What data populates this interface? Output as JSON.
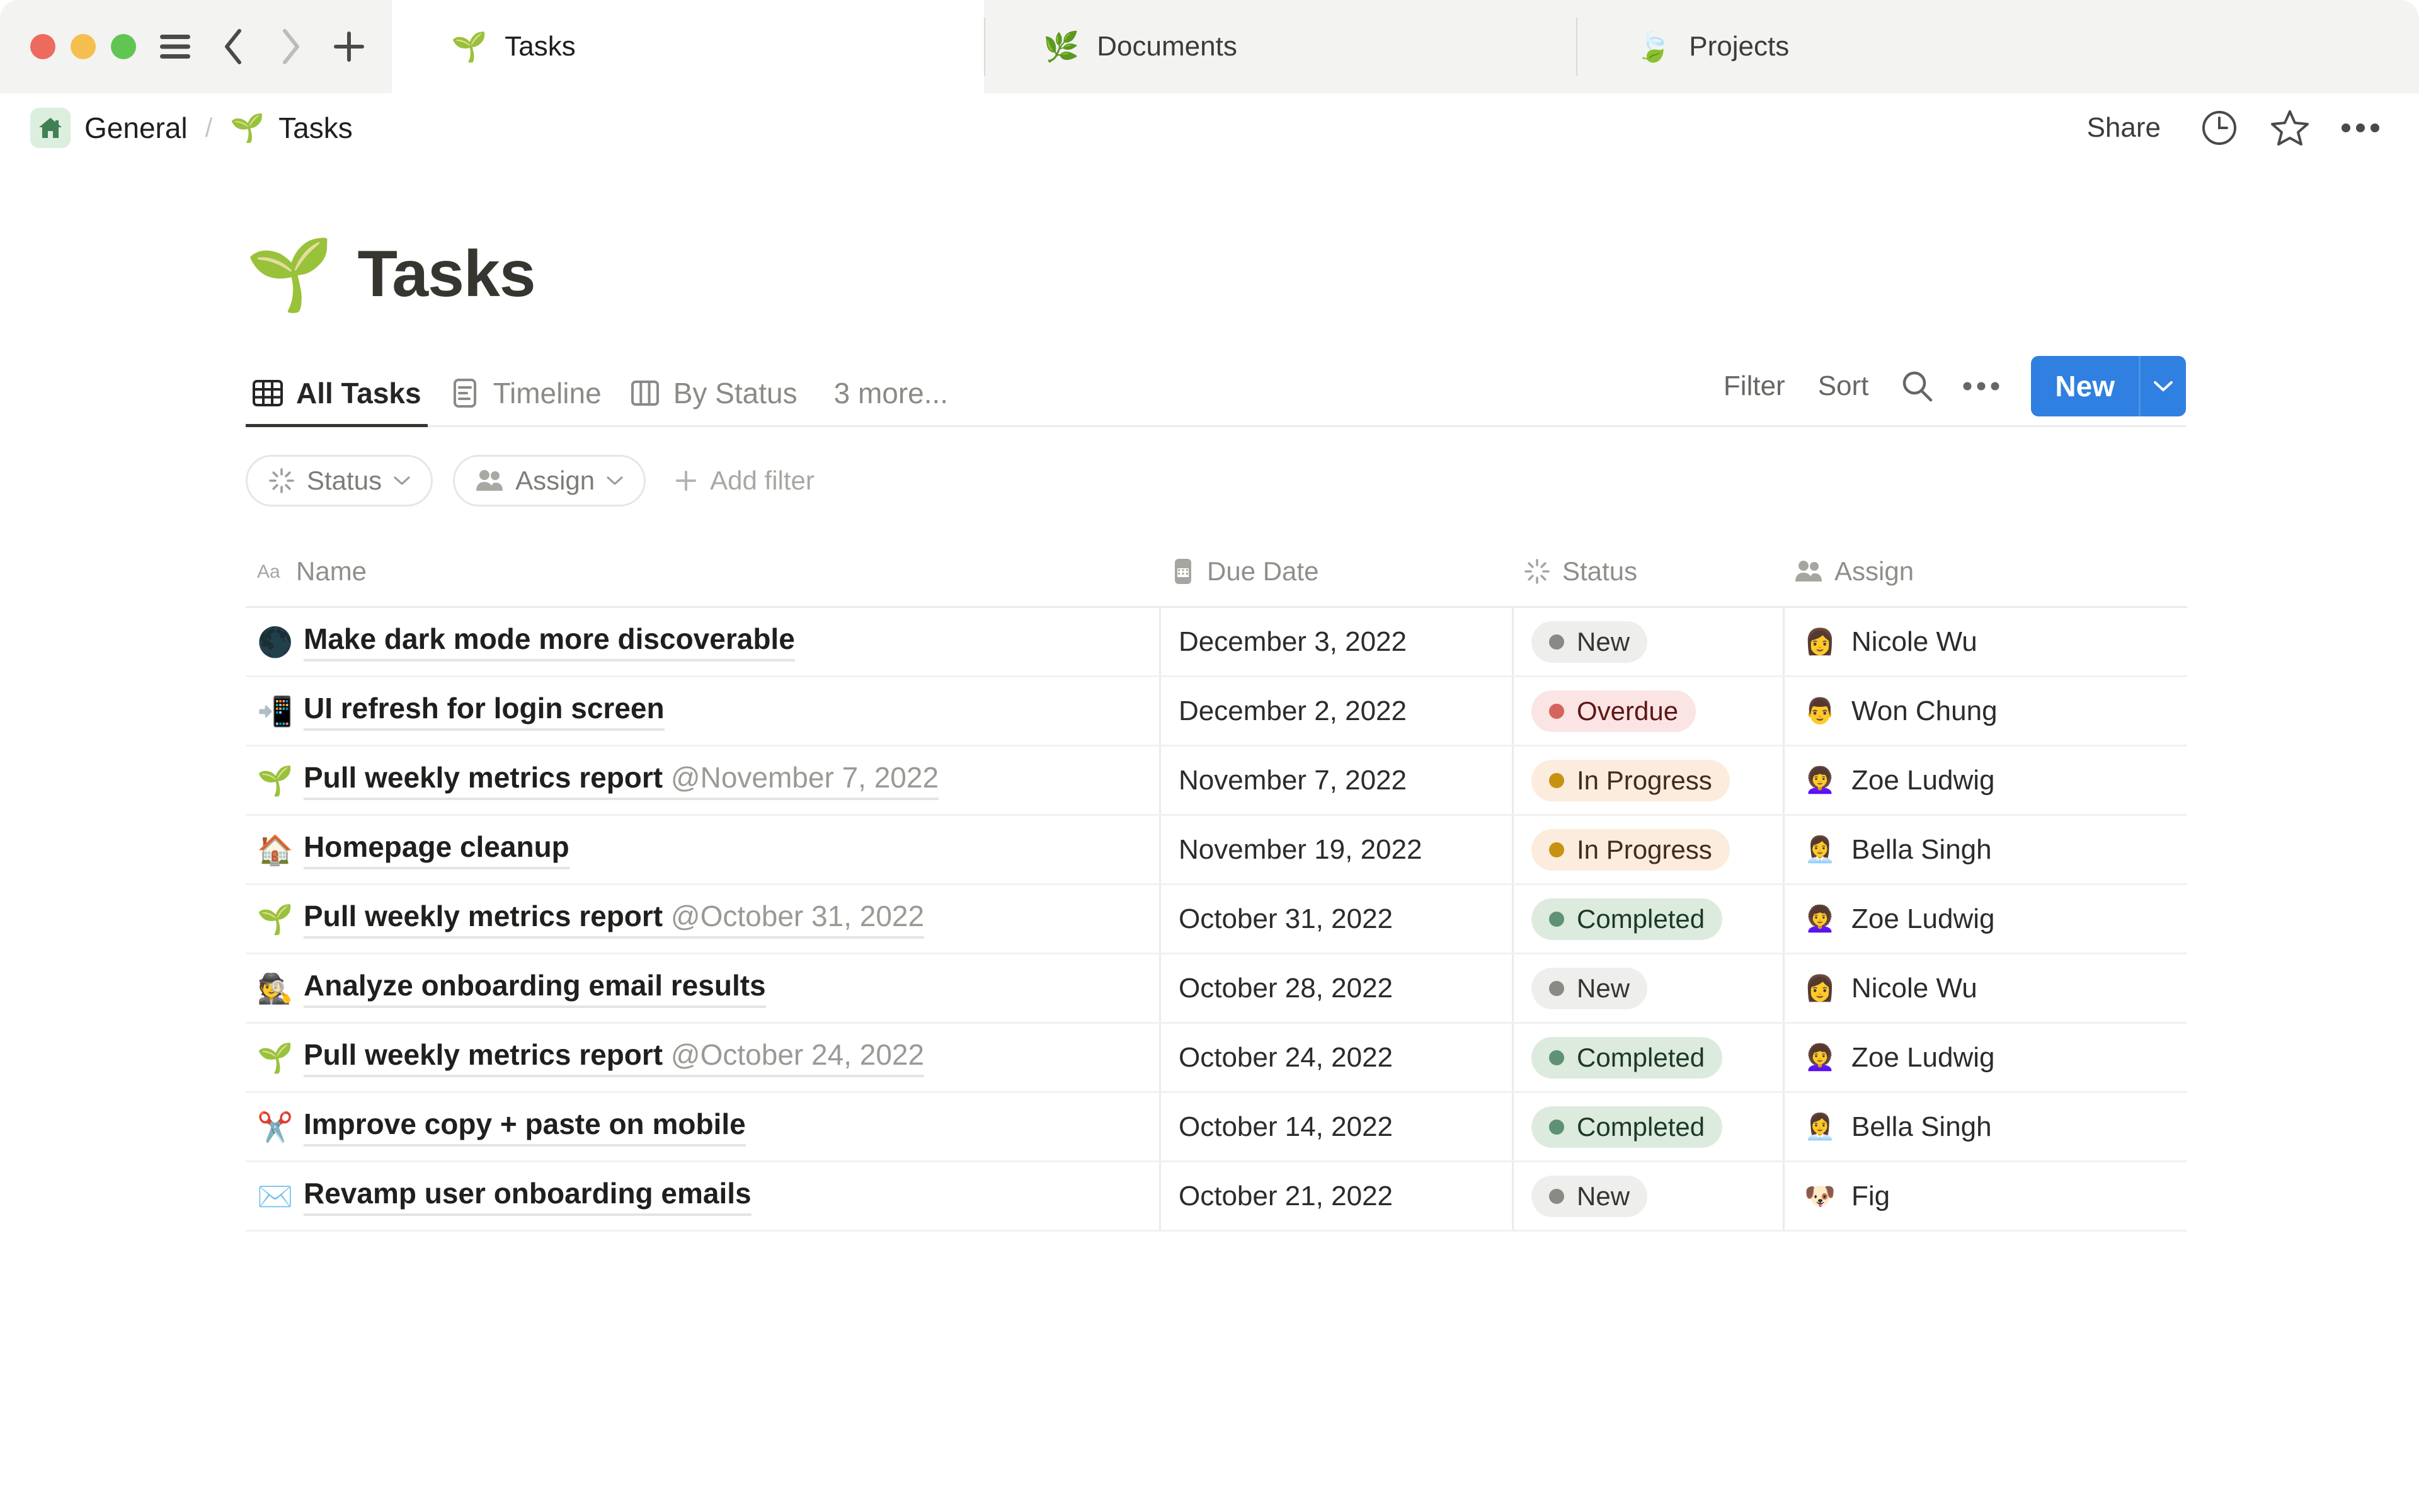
{
  "window": {
    "traffic_lights": [
      "close",
      "minimize",
      "maximize"
    ],
    "sidebar_toggle_icon": "hamburger-icon",
    "back_icon": "chevron-left-icon",
    "forward_icon": "chevron-right-icon",
    "new_tab_icon": "plus-icon",
    "tabs": [
      {
        "label": "Tasks",
        "emoji": "🌱",
        "active": true
      },
      {
        "label": "Documents",
        "emoji": "🌿",
        "active": false
      },
      {
        "label": "Projects",
        "emoji": "🍃",
        "active": false
      }
    ]
  },
  "topbar": {
    "breadcrumb": [
      {
        "label": "General",
        "icon": "home-icon"
      },
      {
        "label": "Tasks",
        "emoji": "🌱"
      }
    ],
    "separator": "/",
    "share_label": "Share",
    "history_icon": "clock-icon",
    "favorite_icon": "star-icon",
    "more_icon": "ellipsis-icon"
  },
  "page": {
    "emoji": "🌱",
    "title": "Tasks"
  },
  "views": {
    "tabs": [
      {
        "label": "All Tasks",
        "icon": "table-icon",
        "active": true
      },
      {
        "label": "Timeline",
        "icon": "timeline-icon",
        "active": false
      },
      {
        "label": "By Status",
        "icon": "board-icon",
        "active": false
      }
    ],
    "more_label": "3 more...",
    "filter_label": "Filter",
    "sort_label": "Sort",
    "search_icon": "search-icon",
    "more_icon": "ellipsis-icon",
    "new_label": "New",
    "new_caret_icon": "chevron-down-icon"
  },
  "filters": {
    "chips": [
      {
        "label": "Status",
        "icon": "status-icon",
        "caret": "chevron-down-icon"
      },
      {
        "label": "Assign",
        "icon": "people-icon",
        "caret": "chevron-down-icon"
      }
    ],
    "add_filter_label": "Add filter",
    "add_filter_icon": "plus-icon"
  },
  "table": {
    "columns": [
      {
        "label": "Name",
        "icon": "text-type-icon"
      },
      {
        "label": "Due Date",
        "icon": "calendar-icon"
      },
      {
        "label": "Status",
        "icon": "status-icon"
      },
      {
        "label": "Assign",
        "icon": "people-icon"
      }
    ],
    "rows": [
      {
        "emoji": "🌑",
        "name": "Make dark mode more discoverable",
        "mention": "",
        "due_date": "December 3, 2022",
        "status": "New",
        "status_bg": "#eeeeec",
        "status_fg": "#37352f",
        "status_dot": "#8a8a85",
        "assignee": "Nicole Wu",
        "avatar": "👩"
      },
      {
        "emoji": "📲",
        "name": "UI refresh for login screen",
        "mention": "",
        "due_date": "December 2, 2022",
        "status": "Overdue",
        "status_bg": "#fbe4e4",
        "status_fg": "#5d1715",
        "status_dot": "#d4645c",
        "assignee": "Won Chung",
        "avatar": "👨"
      },
      {
        "emoji": "🌱",
        "name": "Pull weekly metrics report ",
        "mention": "@November 7, 2022",
        "due_date": "November 7, 2022",
        "status": "In Progress",
        "status_bg": "#fbecdd",
        "status_fg": "#402b1c",
        "status_dot": "#c79211",
        "assignee": "Zoe Ludwig",
        "avatar": "👩‍🦱"
      },
      {
        "emoji": "🏠",
        "name": "Homepage cleanup",
        "mention": "",
        "due_date": "November 19, 2022",
        "status": "In Progress",
        "status_bg": "#fbecdd",
        "status_fg": "#402b1c",
        "status_dot": "#c79211",
        "assignee": "Bella Singh",
        "avatar": "👩‍💼"
      },
      {
        "emoji": "🌱",
        "name": "Pull weekly metrics report ",
        "mention": "@October 31, 2022",
        "due_date": "October 31, 2022",
        "status": "Completed",
        "status_bg": "#dcebdd",
        "status_fg": "#1c3829",
        "status_dot": "#5e9175",
        "assignee": "Zoe Ludwig",
        "avatar": "👩‍🦱"
      },
      {
        "emoji": "🕵️",
        "name": "Analyze onboarding email results",
        "mention": "",
        "due_date": "October 28, 2022",
        "status": "New",
        "status_bg": "#eeeeec",
        "status_fg": "#37352f",
        "status_dot": "#8a8a85",
        "assignee": "Nicole Wu",
        "avatar": "👩"
      },
      {
        "emoji": "🌱",
        "name": "Pull weekly metrics report ",
        "mention": "@October 24, 2022",
        "due_date": "October 24, 2022",
        "status": "Completed",
        "status_bg": "#dcebdd",
        "status_fg": "#1c3829",
        "status_dot": "#5e9175",
        "assignee": "Zoe Ludwig",
        "avatar": "👩‍🦱"
      },
      {
        "emoji": "✂️",
        "name": "Improve copy + paste on mobile",
        "mention": "",
        "due_date": "October 14, 2022",
        "status": "Completed",
        "status_bg": "#dcebdd",
        "status_fg": "#1c3829",
        "status_dot": "#5e9175",
        "assignee": "Bella Singh",
        "avatar": "👩‍💼"
      },
      {
        "emoji": "✉️",
        "name": "Revamp user onboarding emails",
        "mention": "",
        "due_date": "October 21, 2022",
        "status": "New",
        "status_bg": "#eeeeec",
        "status_fg": "#37352f",
        "status_dot": "#8a8a85",
        "assignee": "Fig",
        "avatar": "🐶"
      }
    ]
  },
  "colors": {
    "accent": "#2f80e0",
    "chrome_bg": "#f3f3f1",
    "text": "#37352f"
  }
}
